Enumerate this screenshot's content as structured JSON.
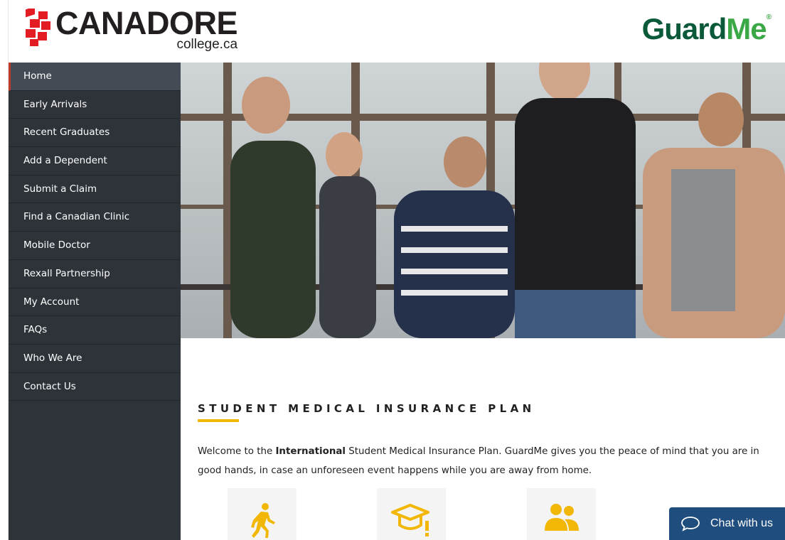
{
  "header": {
    "canadore_logo": {
      "wordmark": "CANADORE",
      "subtext": "college.ca"
    },
    "guardme_logo": {
      "part1": "G",
      "part2": "uard",
      "part3": "Me",
      "tm": "®"
    }
  },
  "sidebar": {
    "items": [
      {
        "label": "Home",
        "active": true
      },
      {
        "label": "Early Arrivals"
      },
      {
        "label": "Recent Graduates"
      },
      {
        "label": "Add a Dependent"
      },
      {
        "label": "Submit a Claim"
      },
      {
        "label": "Find a Canadian Clinic"
      },
      {
        "label": "Mobile Doctor"
      },
      {
        "label": "Rexall Partnership"
      },
      {
        "label": "My Account"
      },
      {
        "label": "FAQs"
      },
      {
        "label": "Who We Are"
      },
      {
        "label": "Contact Us"
      }
    ]
  },
  "main": {
    "section_title": "STUDENT MEDICAL INSURANCE PLAN",
    "intro_before": "Welcome to the ",
    "intro_bold": "International",
    "intro_after": " Student Medical Insurance Plan. GuardMe gives you the peace of mind that you are in good hands, in case an unforeseen event happens while you are away from home.",
    "tiles": [
      {
        "icon": "walking-person-icon"
      },
      {
        "icon": "graduation-cap-alert-icon"
      },
      {
        "icon": "users-group-icon"
      }
    ]
  },
  "chat": {
    "label": "Chat with us",
    "icon": "speech-bubble-icon"
  },
  "colors": {
    "sidebar_bg": "#2e333a",
    "accent_yellow": "#f2b705",
    "canadore_red": "#e31b23",
    "guardme_dark_green": "#0a5a3a",
    "guardme_green": "#3aa845",
    "chat_blue": "#1f4e7e"
  }
}
